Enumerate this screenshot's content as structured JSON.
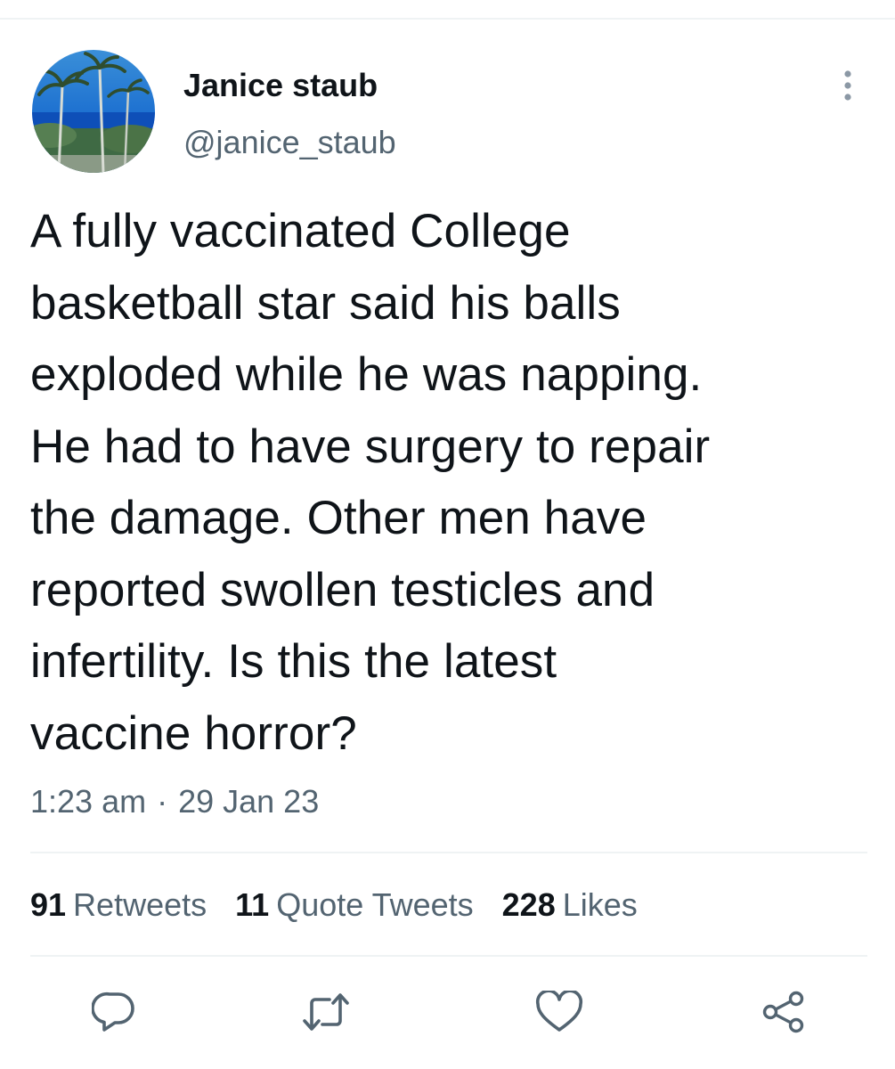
{
  "author": {
    "display_name": "Janice staub",
    "handle": "@janice_staub",
    "avatar_icon": "avatar-palm-trees-beach"
  },
  "more_icon": "more-vertical-icon",
  "tweet": {
    "text": "A fully vaccinated College\nbasketball star said his balls\nexploded while he was napping.\nHe had to have surgery to repair\nthe damage. Other men have\nreported swollen testicles and\ninfertility. Is this the latest\nvaccine horror?",
    "time": "1:23 am",
    "separator": "·",
    "date": "29 Jan 23"
  },
  "stats": {
    "retweets": {
      "count": "91",
      "label": "Retweets"
    },
    "quote_tweets": {
      "count": "11",
      "label": "Quote Tweets"
    },
    "likes": {
      "count": "228",
      "label": "Likes"
    }
  },
  "actions": [
    {
      "name": "reply",
      "icon": "reply-icon"
    },
    {
      "name": "retweet",
      "icon": "retweet-icon"
    },
    {
      "name": "like",
      "icon": "heart-icon"
    },
    {
      "name": "share",
      "icon": "share-icon"
    }
  ],
  "colors": {
    "text_primary": "#0f1419",
    "text_secondary": "#536471",
    "divider": "#eff3f4",
    "icon": "#536471"
  }
}
